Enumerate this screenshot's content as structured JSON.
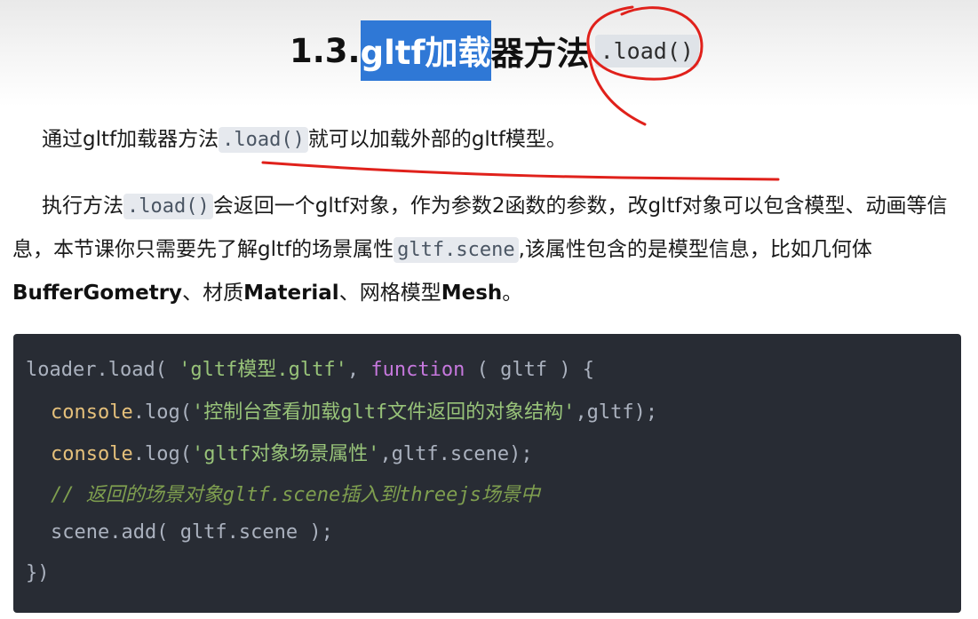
{
  "heading": {
    "prefix": "1.3.",
    "highlighted": "gltf加载",
    "rest": "器方法",
    "code": ".load()"
  },
  "para1": {
    "before": "通过gltf加载器方法",
    "code": ".load()",
    "after": "就可以加载外部的gltf模型。"
  },
  "para2": {
    "t1": "执行方法",
    "code1": ".load()",
    "t2": "会返回一个gltf对象，作为参数2函数的参数，改gltf对象可以包含模型、动画等信息，本节课你只需要先了解gltf的场景属性",
    "code2": "gltf.scene",
    "t3": ",该属性包含的是模型信息，比如几何体",
    "b1": "BufferGometry",
    "t4": "、材质",
    "b2": "Material",
    "t5": "、网格模型",
    "b3": "Mesh",
    "t6": "。"
  },
  "code": {
    "l1_a": "loader.load( ",
    "l1_str": "'gltf模型.gltf'",
    "l1_b": ", ",
    "l1_kw": "function",
    "l1_c": " ( gltf ) {",
    "l2_obj": "console",
    "l2_a": ".log(",
    "l2_str": "'控制台查看加载gltf文件返回的对象结构'",
    "l2_b": ",gltf);",
    "l3_obj": "console",
    "l3_a": ".log(",
    "l3_str": "'gltf对象场景属性'",
    "l3_b": ",gltf.scene);",
    "l4_cmt": "// 返回的场景对象gltf.scene插入到threejs场景中",
    "l5": "scene.add( gltf.scene );",
    "l6": "})"
  },
  "colors": {
    "selection": "#2f78d6",
    "code_bg": "#282c34",
    "string": "#98c379",
    "keyword": "#c678dd",
    "object": "#e5c07b",
    "comment": "#7f9f4f",
    "annotation": "#e0211b"
  }
}
